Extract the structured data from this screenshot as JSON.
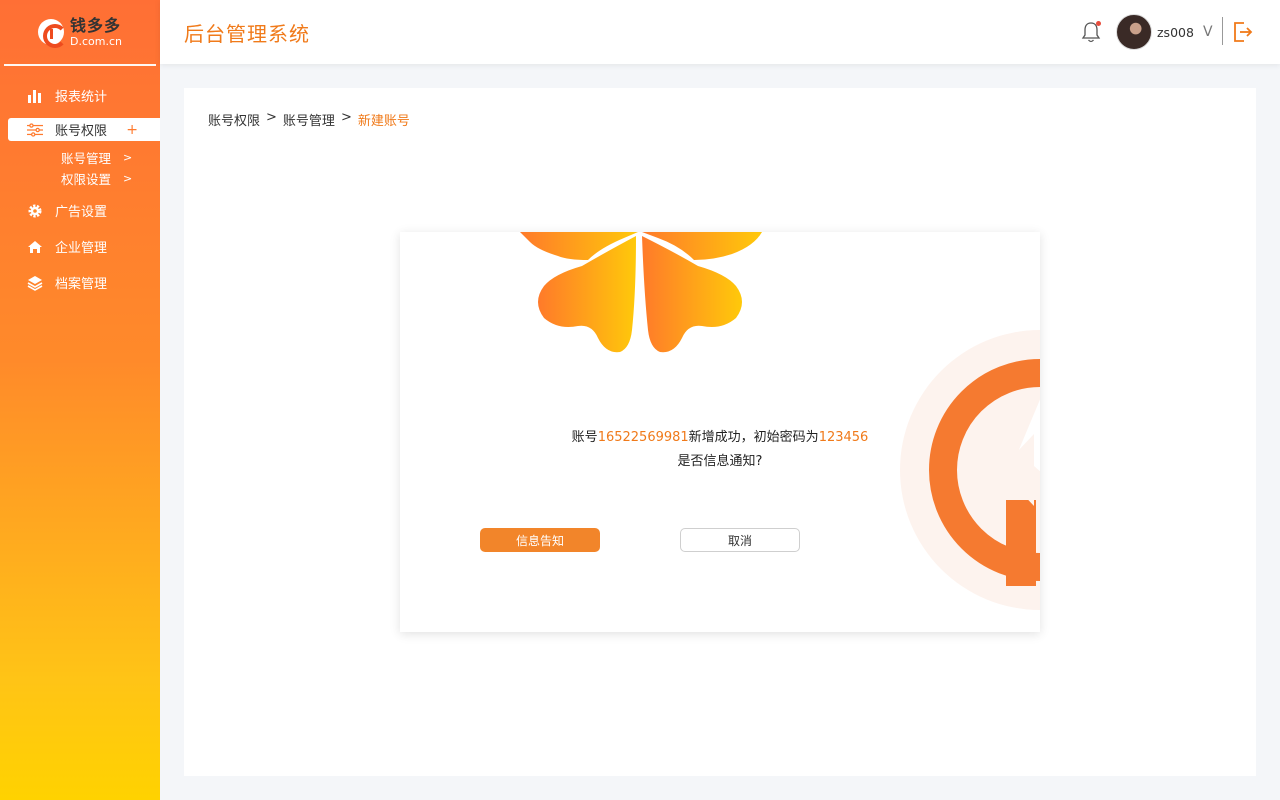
{
  "brand": {
    "name": "钱多多",
    "domain": "D.com.cn"
  },
  "app_title": "后台管理系统",
  "sidebar": {
    "items": [
      {
        "label": "报表统计",
        "icon": "bar-chart-icon"
      },
      {
        "label": "账号权限",
        "icon": "sliders-icon",
        "active": true,
        "action": "+"
      },
      {
        "label": "广告设置",
        "icon": "gear-icon"
      },
      {
        "label": "企业管理",
        "icon": "home-icon"
      },
      {
        "label": "档案管理",
        "icon": "layers-icon"
      }
    ],
    "sub_items": [
      {
        "label": "账号管理",
        "chevron": ">"
      },
      {
        "label": "权限设置",
        "chevron": ">"
      }
    ]
  },
  "header": {
    "username": "zs008",
    "user_chevron": "V"
  },
  "breadcrumb": {
    "level1": "账号权限",
    "sep1": ">",
    "level2": "账号管理",
    "sep2": ">",
    "current": "新建账号"
  },
  "dialog": {
    "line1_prefix": "账号",
    "account": "16522569981",
    "line1_mid": "新增成功，初始密码为",
    "password": "123456",
    "line2": "是否信息通知?",
    "confirm_label": "信息告知",
    "cancel_label": "取消"
  },
  "colors": {
    "accent": "#f07a1a",
    "sidebar_top": "#ff6f35",
    "sidebar_bottom": "#ffd200",
    "button": "#f2852a"
  }
}
